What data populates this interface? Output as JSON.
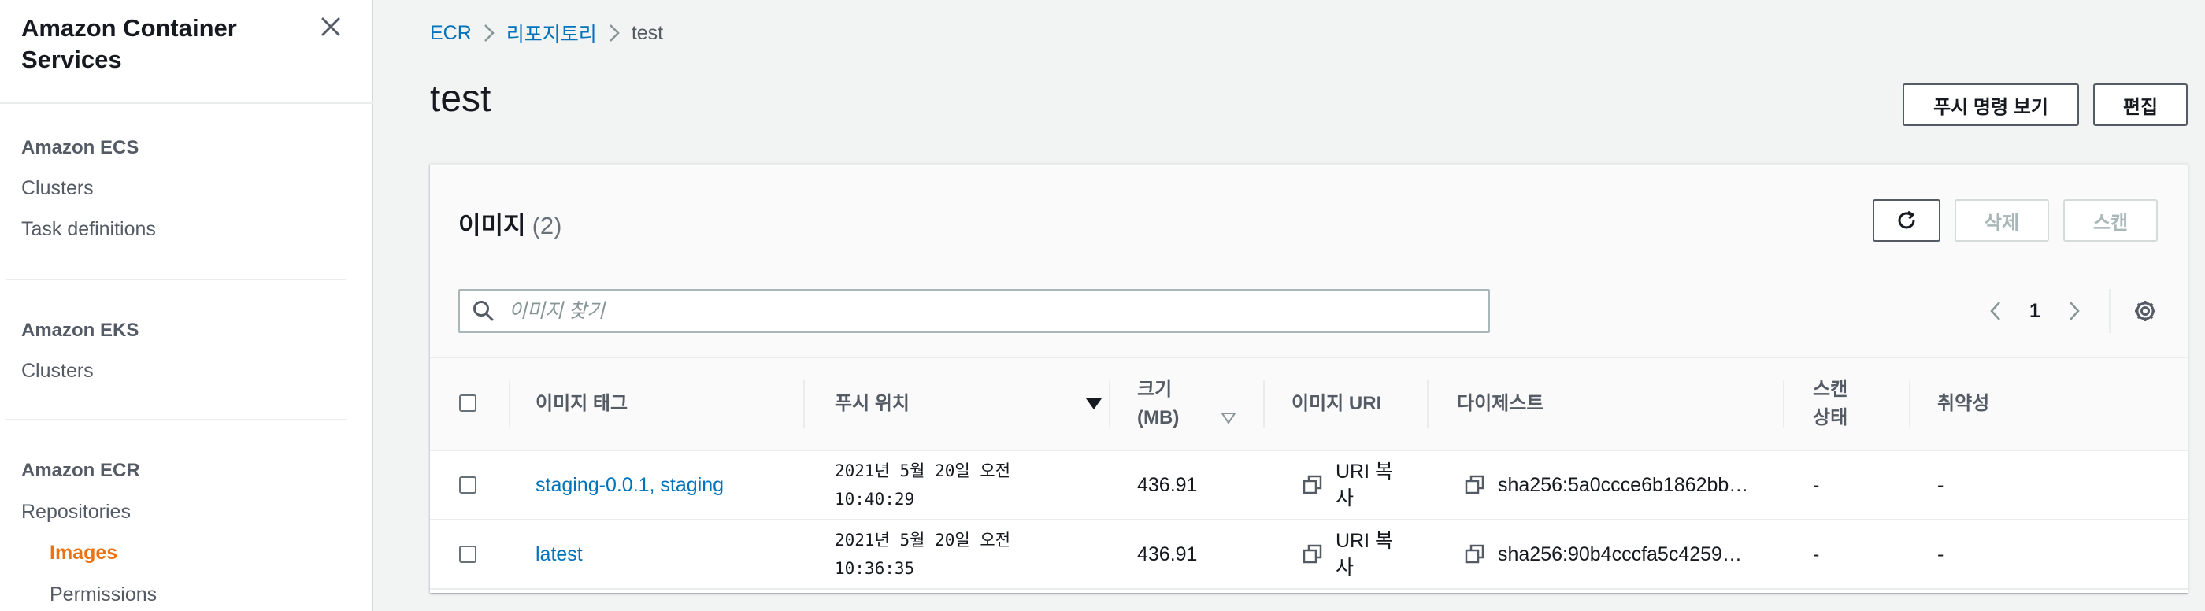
{
  "sidebar": {
    "title": "Amazon Container Services",
    "sections": [
      {
        "heading": "Amazon ECS",
        "items": [
          {
            "label": "Clusters"
          },
          {
            "label": "Task definitions"
          }
        ]
      },
      {
        "heading": "Amazon EKS",
        "items": [
          {
            "label": "Clusters"
          }
        ]
      },
      {
        "heading": "Amazon ECR",
        "items": [
          {
            "label": "Repositories"
          },
          {
            "label": "Images",
            "active": true
          },
          {
            "label": "Permissions"
          }
        ]
      }
    ]
  },
  "breadcrumb": [
    "ECR",
    "리포지토리",
    "test"
  ],
  "page": {
    "title": "test",
    "push_commands_button": "푸시 명령 보기",
    "edit_button": "편집"
  },
  "images_panel": {
    "title": "이미지",
    "count": "(2)",
    "delete_button": "삭제",
    "scan_button": "스캔",
    "search_placeholder": "이미지 찾기",
    "current_page": "1"
  },
  "table": {
    "columns": {
      "tag": "이미지 태그",
      "pushed_at": "푸시 위치",
      "size_line1": "크기",
      "size_line2": "(MB)",
      "uri": "이미지 URI",
      "digest": "다이제스트",
      "scan_line1": "스캔",
      "scan_line2": "상태",
      "vuln": "취약성"
    },
    "rows": [
      {
        "tag": "staging-0.0.1, staging",
        "pushed_line1": "2021년 5월 20일 오전",
        "pushed_line2": "10:40:29",
        "size": "436.91",
        "uri": "URI 복사",
        "digest": "sha256:5a0ccce6b1862bb…",
        "scan": "-",
        "vuln": "-"
      },
      {
        "tag": "latest",
        "pushed_line1": "2021년 5월 20일 오전",
        "pushed_line2": "10:36:35",
        "size": "436.91",
        "uri": "URI 복사",
        "digest": "sha256:90b4cccfa5c4259…",
        "scan": "-",
        "vuln": "-"
      }
    ]
  },
  "colors": {
    "link": "#0073bb",
    "active_nav": "#ec7211",
    "background": "#f2f3f3"
  },
  "icons": [
    "close-icon",
    "chevron-right-icon",
    "refresh-icon",
    "search-icon",
    "chevron-left-icon",
    "gear-icon",
    "sort-desc-icon",
    "sort-icon",
    "copy-icon"
  ]
}
